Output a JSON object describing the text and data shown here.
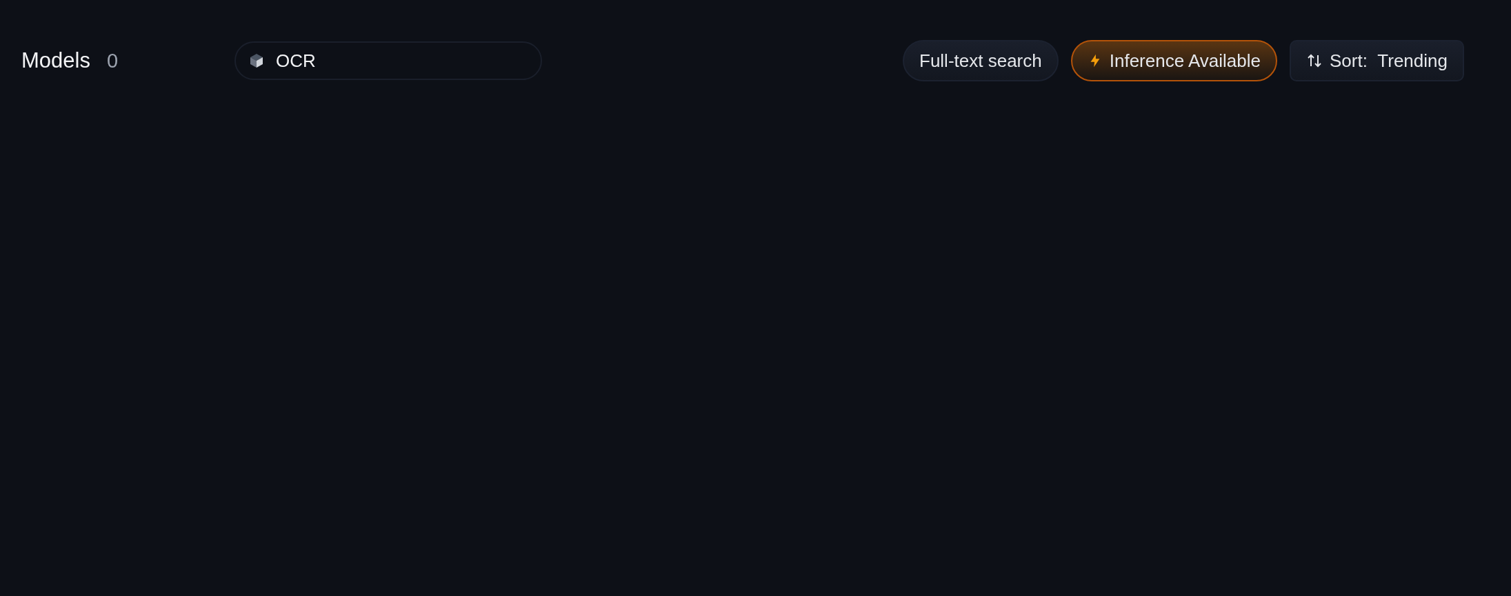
{
  "header": {
    "title": "Models",
    "count": "0"
  },
  "filter": {
    "value": "OCR"
  },
  "buttons": [
    {
      "kind": "fulltext",
      "label": "Full-text search",
      "on": false
    },
    {
      "kind": "inference",
      "label": "Inference Available",
      "on": true
    }
  ],
  "sort": {
    "label": "Sort:",
    "value": "Trending"
  }
}
